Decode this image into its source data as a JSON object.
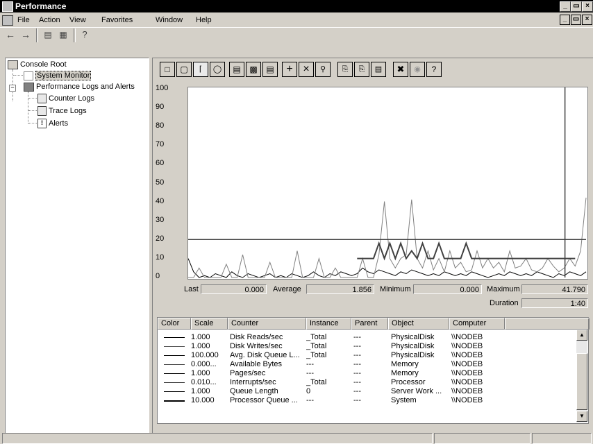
{
  "window": {
    "title": "Performance"
  },
  "menu": {
    "items": [
      "File",
      "Action",
      "View",
      "Favorites",
      "Window",
      "Help"
    ]
  },
  "tree": {
    "root": "Console Root",
    "system_monitor": "System Monitor",
    "perf_logs": "Performance Logs and Alerts",
    "counter_logs": "Counter Logs",
    "trace_logs": "Trace Logs",
    "alerts": "Alerts"
  },
  "chart_data": {
    "type": "line",
    "yticks": [
      "100",
      "90",
      "80",
      "70",
      "60",
      "50",
      "40",
      "30",
      "20",
      "10",
      "0"
    ],
    "ylim": [
      0,
      100
    ],
    "series": [
      {
        "values": [
          10,
          3,
          0,
          1,
          0,
          2,
          1,
          0,
          3,
          1,
          0,
          2,
          1,
          0,
          1,
          2,
          0,
          1,
          0,
          2,
          1,
          0,
          1,
          3,
          1,
          0,
          2,
          1,
          3,
          2,
          1,
          2,
          5,
          3,
          2,
          4,
          3,
          2,
          1,
          3,
          2,
          4,
          3,
          2,
          1,
          2,
          1,
          3,
          2,
          1,
          2,
          1,
          3,
          2,
          1,
          0,
          1,
          2,
          1,
          3,
          2,
          1,
          2,
          1,
          3,
          2,
          1,
          0,
          2,
          1,
          3,
          2,
          1,
          3
        ]
      },
      {
        "values": [
          0,
          0,
          5,
          0,
          0,
          0,
          0,
          7,
          0,
          0,
          12,
          0,
          0,
          0,
          0,
          8,
          0,
          0,
          0,
          0,
          14,
          0,
          0,
          0,
          10,
          0,
          0,
          5,
          0,
          0,
          0,
          0,
          10,
          0,
          0,
          12,
          40,
          10,
          5,
          10,
          12,
          41,
          10,
          5,
          14,
          4,
          10,
          3,
          14,
          5,
          8,
          3,
          4,
          14,
          5,
          10,
          5,
          8,
          3,
          14,
          5,
          6,
          10,
          4,
          3,
          5,
          10,
          6,
          3,
          5,
          10,
          6,
          14,
          42
        ]
      },
      {
        "values": [
          20,
          20,
          20,
          20,
          20,
          20,
          20,
          20,
          20,
          20,
          20,
          20,
          20,
          20,
          20,
          20,
          20,
          20,
          20,
          20,
          20,
          20,
          20,
          20,
          20,
          20,
          20,
          20,
          20,
          20,
          20,
          20,
          20,
          20,
          20,
          20,
          20,
          20,
          20,
          20,
          20,
          20,
          20,
          20,
          20,
          20,
          20,
          20,
          20,
          20,
          20,
          20,
          20,
          20,
          20,
          20,
          20,
          20,
          20,
          20,
          20,
          20,
          20,
          20,
          20,
          20,
          20,
          20,
          20,
          20,
          20,
          20,
          20,
          20
        ]
      },
      {
        "values": [
          null,
          null,
          null,
          null,
          null,
          null,
          null,
          null,
          null,
          null,
          null,
          null,
          null,
          null,
          null,
          null,
          null,
          null,
          null,
          null,
          null,
          null,
          null,
          null,
          null,
          null,
          null,
          null,
          null,
          null,
          null,
          10,
          10,
          10,
          10,
          18,
          10,
          18,
          10,
          18,
          10,
          14,
          10,
          18,
          10,
          10,
          18,
          10,
          10,
          10,
          10,
          18,
          10,
          10,
          10,
          10,
          10,
          10,
          10,
          10,
          10,
          10,
          10,
          10,
          10,
          10,
          10,
          10,
          10,
          10,
          10,
          10,
          null,
          null
        ]
      }
    ],
    "last": "0.000",
    "average": "1.856",
    "minimum": "0.000",
    "maximum": "41.790",
    "duration": "1:40"
  },
  "stats_labels": {
    "last": "Last",
    "average": "Average",
    "minimum": "Minimum",
    "maximum": "Maximum",
    "duration": "Duration"
  },
  "legend": {
    "headers": [
      "Color",
      "Scale",
      "Counter",
      "Instance",
      "Parent",
      "Object",
      "Computer"
    ],
    "rows": [
      {
        "scale": "1.000",
        "counter": "Disk Reads/sec",
        "instance": "_Total",
        "parent": "---",
        "object": "PhysicalDisk",
        "computer": "\\\\NODEB"
      },
      {
        "scale": "1.000",
        "counter": "Disk Writes/sec",
        "instance": "_Total",
        "parent": "---",
        "object": "PhysicalDisk",
        "computer": "\\\\NODEB"
      },
      {
        "scale": "100.000",
        "counter": "Avg. Disk Queue L...",
        "instance": "_Total",
        "parent": "---",
        "object": "PhysicalDisk",
        "computer": "\\\\NODEB"
      },
      {
        "scale": "0.000...",
        "counter": "Available Bytes",
        "instance": "---",
        "parent": "---",
        "object": "Memory",
        "computer": "\\\\NODEB"
      },
      {
        "scale": "1.000",
        "counter": "Pages/sec",
        "instance": "---",
        "parent": "---",
        "object": "Memory",
        "computer": "\\\\NODEB"
      },
      {
        "scale": "0.010...",
        "counter": "Interrupts/sec",
        "instance": "_Total",
        "parent": "---",
        "object": "Processor",
        "computer": "\\\\NODEB"
      },
      {
        "scale": "1.000",
        "counter": "Queue Length",
        "instance": "0",
        "parent": "---",
        "object": "Server Work ...",
        "computer": "\\\\NODEB"
      },
      {
        "scale": "10.000",
        "counter": "Processor Queue ...",
        "instance": "---",
        "parent": "---",
        "object": "System",
        "computer": "\\\\NODEB"
      }
    ]
  }
}
